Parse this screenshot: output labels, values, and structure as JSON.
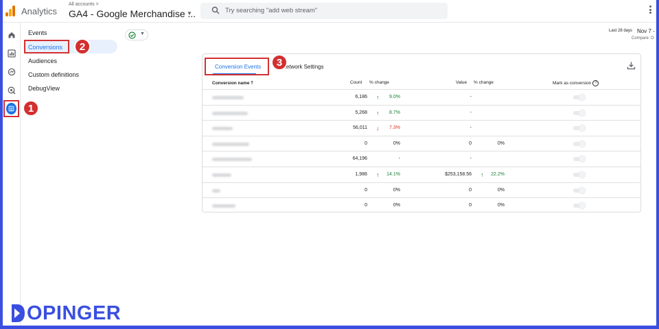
{
  "header": {
    "app_title": "Analytics",
    "breadcrumb": "All accounts >",
    "property_name": "GA4 - Google Merchandise ...",
    "search_placeholder": "Try searching \"add web stream\""
  },
  "rail": [
    "home-icon",
    "reports-icon",
    "explore-icon",
    "advertising-icon",
    "admin-configure-icon"
  ],
  "subnav": {
    "items": [
      {
        "label": "Events"
      },
      {
        "label": "Conversions"
      },
      {
        "label": "Audiences"
      },
      {
        "label": "Custom definitions"
      },
      {
        "label": "DebugView"
      }
    ],
    "active_index": 1
  },
  "date_range": {
    "label": "Last 28 days",
    "value": "Nov 7 -",
    "compare": "Compare: O"
  },
  "badges": {
    "one": "1",
    "two": "2",
    "three": "3"
  },
  "tabs": [
    {
      "label": "Conversion Events",
      "active": true
    },
    {
      "label": "Network Settings",
      "active": false
    }
  ],
  "table": {
    "headers": {
      "name": "Conversion name",
      "count": "Count",
      "count_change": "% change",
      "value": "Value",
      "value_change": "% change",
      "mark": "Mark as conversion"
    },
    "rows": [
      {
        "count": "6,186",
        "count_change": "9.0%",
        "count_dir": "up",
        "value": "-",
        "value_change": "",
        "value_dir": ""
      },
      {
        "count": "5,268",
        "count_change": "8.7%",
        "count_dir": "up",
        "value": "-",
        "value_change": "",
        "value_dir": ""
      },
      {
        "count": "56,011",
        "count_change": "7.3%",
        "count_dir": "down",
        "value": "-",
        "value_change": "",
        "value_dir": ""
      },
      {
        "count": "0",
        "count_change": "0%",
        "count_dir": "",
        "value": "0",
        "value_change": "0%",
        "value_dir": ""
      },
      {
        "count": "64,196",
        "count_change": "-",
        "count_dir": "",
        "value": "-",
        "value_change": "",
        "value_dir": ""
      },
      {
        "count": "1,986",
        "count_change": "14.1%",
        "count_dir": "up",
        "value": "$253,158.56",
        "value_change": "22.2%",
        "value_dir": "up"
      },
      {
        "count": "0",
        "count_change": "0%",
        "count_dir": "",
        "value": "0",
        "value_change": "0%",
        "value_dir": ""
      },
      {
        "count": "0",
        "count_change": "0%",
        "count_dir": "",
        "value": "0",
        "value_change": "0%",
        "value_dir": ""
      }
    ]
  },
  "watermark": "OPINGER",
  "colors": {
    "accent": "#1a73e8",
    "annotation": "#d32f2f",
    "positive": "#188038",
    "negative": "#d93025",
    "brand": "#3a4fe0"
  }
}
